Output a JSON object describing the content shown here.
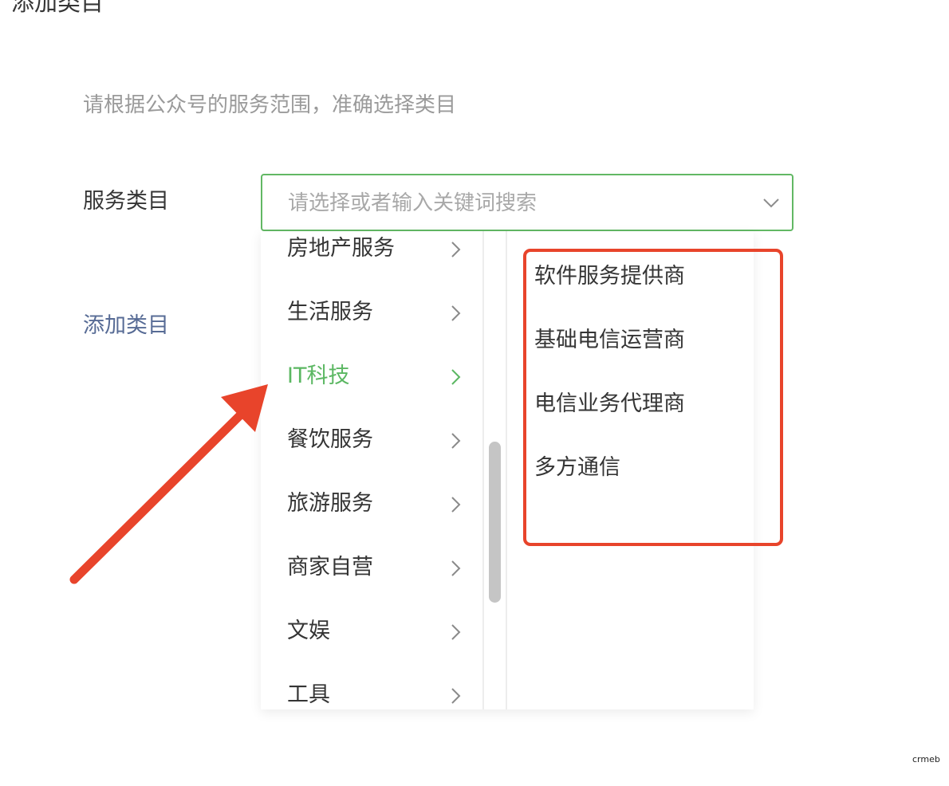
{
  "page": {
    "title": "添加类目",
    "subtitle": "请根据公众号的服务范围，准确选择类目",
    "field_label": "服务类目",
    "add_link": "添加类目"
  },
  "select": {
    "placeholder": "请选择或者输入关键词搜索",
    "value": "",
    "icon": "chevron-down-icon",
    "border_color": "#62b864"
  },
  "categories": [
    {
      "label": "房地产服务",
      "active": false
    },
    {
      "label": "生活服务",
      "active": false
    },
    {
      "label": "IT科技",
      "active": true
    },
    {
      "label": "餐饮服务",
      "active": false
    },
    {
      "label": "旅游服务",
      "active": false
    },
    {
      "label": "商家自营",
      "active": false
    },
    {
      "label": "文娱",
      "active": false
    },
    {
      "label": "工具",
      "active": false
    }
  ],
  "subcategories": [
    {
      "label": "软件服务提供商"
    },
    {
      "label": "基础电信运营商"
    },
    {
      "label": "电信业务代理商"
    },
    {
      "label": "多方通信"
    }
  ],
  "colors": {
    "accent_green": "#5bb762",
    "link_blue": "#576b95",
    "annotation_red": "#e8442b"
  },
  "watermark": "crmeb"
}
